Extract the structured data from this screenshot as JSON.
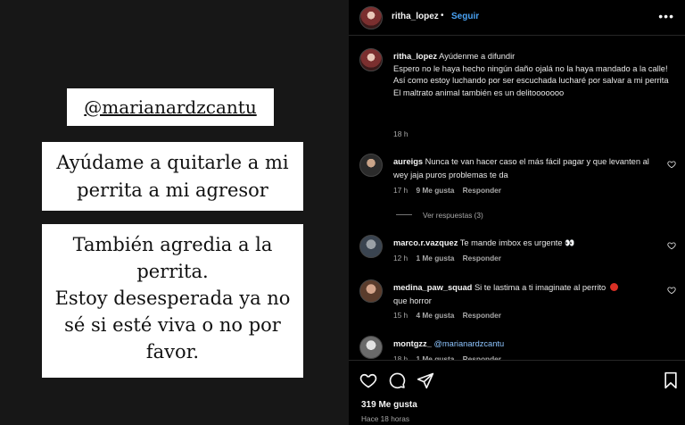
{
  "story": {
    "mention": "@marianardzcantu",
    "help_line1": "Ayúdame a quitarle a mi",
    "help_line2": "perrita a mi agresor",
    "also_lines": [
      "También agredia a la",
      "perrita.",
      "Estoy desesperada ya no",
      "sé si esté viva o no por",
      "favor."
    ]
  },
  "header": {
    "username": "ritha_lopez",
    "separator": "•",
    "follow_label": "Seguir",
    "more_icon": "more-horizontal-icon"
  },
  "caption": {
    "username": "ritha_lopez",
    "lines": [
      "Ayúdenme a difundir",
      "Espero no le haya hecho ningún daño ojalá no la haya mandado a la calle!",
      "Así como estoy luchando por ser escuchada lucharé por salvar a mi perrita",
      "El maltrato animal también es un delitooooooo"
    ],
    "time": "18 h"
  },
  "comments": [
    {
      "username": "aureigs",
      "text": "Nunca te van hacer caso el más fácil pagar y que levanten al wey jaja puros problemas te da",
      "time": "17 h",
      "likes": "9 Me gusta",
      "reply": "Responder"
    },
    {
      "username": "marco.r.vazquez",
      "text": "Te mande imbox es urgente",
      "emoji": "👀",
      "time": "12 h",
      "likes": "1 Me gusta",
      "reply": "Responder"
    },
    {
      "username": "medina_paw_squad",
      "text": "Si te lastima a ti imaginate al perrito",
      "text2": "que horror",
      "time": "15 h",
      "likes": "4 Me gusta",
      "reply": "Responder"
    },
    {
      "username": "montgzz_",
      "text": "@marianardzcantu",
      "time": "18 h",
      "likes": "1 Me gusta",
      "reply": "Responder"
    }
  ],
  "view_replies": "Ver respuestas (3)",
  "actions": {
    "likes_total": "319 Me gusta",
    "posted_ago": "Hace 18 horas"
  },
  "colors": {
    "follow_blue": "#4aa3f5",
    "mention_blue": "#8ec5ff",
    "muted_text": "#a8a8a8"
  }
}
